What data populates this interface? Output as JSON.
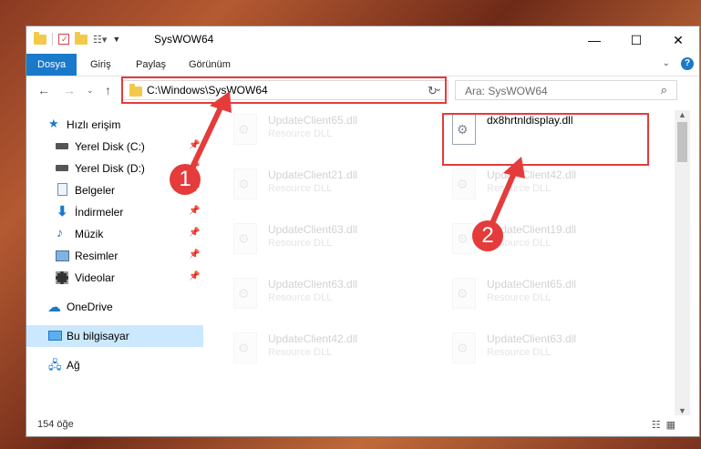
{
  "window": {
    "title": "SysWOW64",
    "minimize": "—",
    "maximize": "☐",
    "close": "✕"
  },
  "ribbon": {
    "tabs": [
      "Dosya",
      "Giriş",
      "Paylaş",
      "Görünüm"
    ],
    "active_tab": "Dosya"
  },
  "address": {
    "path": "C:\\Windows\\SysWOW64",
    "search_placeholder": "Ara: SysWOW64"
  },
  "nav": {
    "quick_access": "Hızlı erişim",
    "items": [
      {
        "label": "Yerel Disk (C:)",
        "icon": "drive-icon",
        "pinned": true
      },
      {
        "label": "Yerel Disk (D:)",
        "icon": "drive-icon",
        "pinned": true
      },
      {
        "label": "Belgeler",
        "icon": "documents-icon",
        "pinned": true
      },
      {
        "label": "İndirmeler",
        "icon": "download-icon",
        "pinned": true
      },
      {
        "label": "Müzik",
        "icon": "music-icon",
        "pinned": true
      },
      {
        "label": "Resimler",
        "icon": "pictures-icon",
        "pinned": true
      },
      {
        "label": "Videolar",
        "icon": "videos-icon",
        "pinned": true
      }
    ],
    "onedrive": "OneDrive",
    "this_pc": "Bu bilgisayar",
    "network": "Ağ"
  },
  "files": {
    "left_column": [
      {
        "name": "UpdateClient65.dll",
        "type": "Resource DLL"
      },
      {
        "name": "UpdateClient21.dll",
        "type": "Resource DLL"
      },
      {
        "name": "UpdateClient63.dll",
        "type": "Resource DLL"
      },
      {
        "name": "UpdateClient63.dll",
        "type": "Resource DLL"
      },
      {
        "name": "UpdateClient42.dll",
        "type": "Resource DLL"
      }
    ],
    "right_column": [
      {
        "name": "dx8hrtnldisplay.dll",
        "type": ""
      },
      {
        "name": "UpdateClient42.dll",
        "type": "Resource DLL"
      },
      {
        "name": "UpdateClient19.dll",
        "type": "Resource DLL"
      },
      {
        "name": "UpdateClient65.dll",
        "type": "Resource DLL"
      },
      {
        "name": "UpdateClient63.dll",
        "type": "Resource DLL"
      }
    ]
  },
  "status": {
    "count": "154 öğe"
  },
  "annotations": {
    "step1": "1",
    "step2": "2",
    "color": "#e53b3b"
  },
  "colors": {
    "accent": "#1979ca",
    "selection": "#cce8ff",
    "folder": "#f3c94b"
  }
}
